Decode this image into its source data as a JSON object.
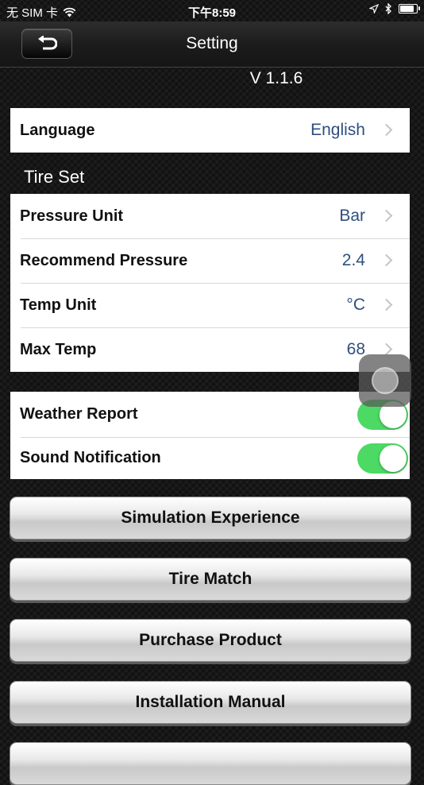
{
  "status_bar": {
    "carrier": "无 SIM 卡",
    "time": "下午8:59",
    "battery_level_percent": 95,
    "icons": [
      "wifi-icon",
      "location-arrow-icon",
      "bluetooth-icon",
      "battery-icon"
    ]
  },
  "nav": {
    "title": "Setting",
    "back_icon": "back-arrow-icon"
  },
  "version": "V 1.1.6",
  "language": {
    "label": "Language",
    "value": "English"
  },
  "tire_set": {
    "header": "Tire Set",
    "rows": [
      {
        "label": "Pressure Unit",
        "value": "Bar"
      },
      {
        "label": "Recommend Pressure",
        "value": "2.4"
      },
      {
        "label": "Temp Unit",
        "value": "°C"
      },
      {
        "label": "Max Temp",
        "value": "68"
      }
    ]
  },
  "toggles": [
    {
      "label": "Weather Report",
      "on": true
    },
    {
      "label": "Sound Notification",
      "on": true
    }
  ],
  "buttons": [
    "Simulation Experience",
    "Tire Match",
    "Purchase Product",
    "Installation Manual"
  ],
  "colors": {
    "toggle_on": "#4cd964",
    "value_text": "#2f4f7d",
    "background": "#121212"
  }
}
